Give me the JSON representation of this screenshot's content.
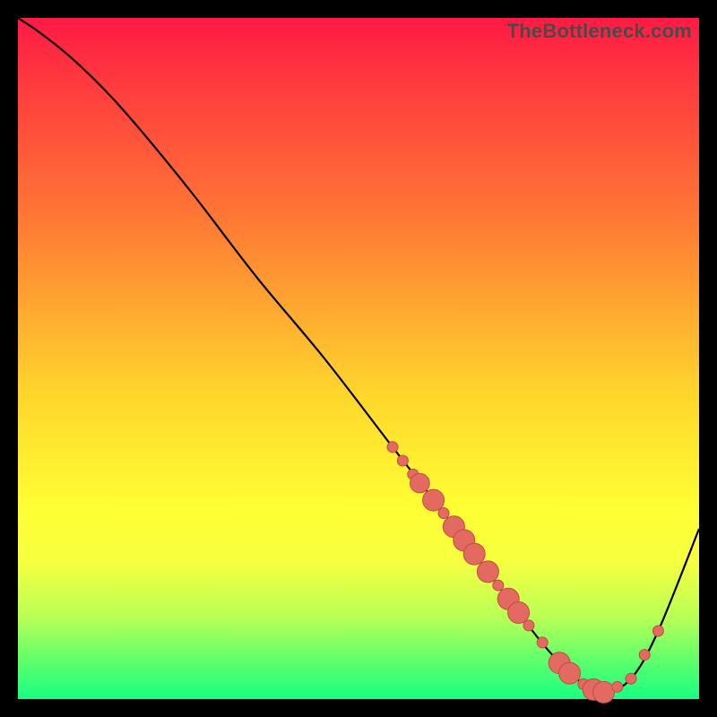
{
  "watermark": "TheBottleneck.com",
  "colors": {
    "background": "#000000",
    "curve": "#000000",
    "marker_fill": "#e36a60",
    "marker_stroke": "#c24b43"
  },
  "chart_data": {
    "type": "line",
    "title": "",
    "xlabel": "",
    "ylabel": "",
    "xlim": [
      0,
      100
    ],
    "ylim": [
      0,
      100
    ],
    "grid": false,
    "legend": false,
    "x": [
      0,
      3,
      8,
      15,
      25,
      35,
      45,
      55,
      62,
      68,
      74,
      78,
      82,
      86,
      90,
      94,
      100
    ],
    "values": [
      100,
      98,
      94,
      87,
      75,
      62,
      50,
      37,
      28,
      20,
      12,
      7,
      3,
      1,
      3,
      10,
      25
    ],
    "markers": [
      {
        "x": 55,
        "y": 37,
        "r": 1.0
      },
      {
        "x": 56.5,
        "y": 35,
        "r": 1.0
      },
      {
        "x": 58,
        "y": 33,
        "r": 1.0
      },
      {
        "x": 59,
        "y": 31.7,
        "r": 1.8
      },
      {
        "x": 61,
        "y": 29.2,
        "r": 2.0
      },
      {
        "x": 62.5,
        "y": 27.3,
        "r": 1.0
      },
      {
        "x": 64,
        "y": 25.3,
        "r": 2.0
      },
      {
        "x": 65.5,
        "y": 23.3,
        "r": 2.0
      },
      {
        "x": 67,
        "y": 21.3,
        "r": 2.0
      },
      {
        "x": 69,
        "y": 18.7,
        "r": 2.0
      },
      {
        "x": 70.5,
        "y": 16.7,
        "r": 1.0
      },
      {
        "x": 72,
        "y": 14.7,
        "r": 2.0
      },
      {
        "x": 73.5,
        "y": 12.7,
        "r": 2.0
      },
      {
        "x": 75,
        "y": 10.8,
        "r": 1.0
      },
      {
        "x": 77,
        "y": 8.3,
        "r": 1.0
      },
      {
        "x": 79.5,
        "y": 5.3,
        "r": 2.0
      },
      {
        "x": 81,
        "y": 3.8,
        "r": 2.0
      },
      {
        "x": 83,
        "y": 2.2,
        "r": 1.0
      },
      {
        "x": 84.5,
        "y": 1.4,
        "r": 2.0
      },
      {
        "x": 86,
        "y": 1.0,
        "r": 2.0
      },
      {
        "x": 88,
        "y": 1.8,
        "r": 1.0
      },
      {
        "x": 90,
        "y": 3.0,
        "r": 1.0
      },
      {
        "x": 92,
        "y": 6.5,
        "r": 1.0
      },
      {
        "x": 94,
        "y": 10.0,
        "r": 1.0
      }
    ]
  }
}
